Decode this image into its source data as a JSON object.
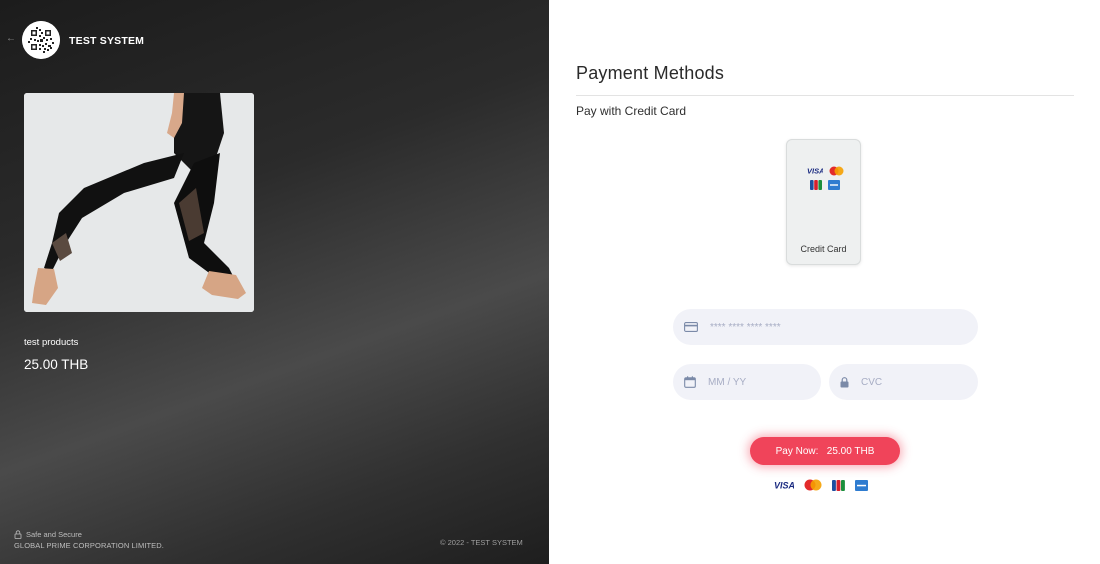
{
  "merchant": {
    "name": "TEST SYSTEM",
    "back_icon": "arrow-left-icon",
    "logo_icon": "qr-logo-icon"
  },
  "product": {
    "name": "test products",
    "price": "25.00 THB"
  },
  "footer": {
    "safe_label": "Safe and Secure",
    "company": "GLOBAL PRIME CORPORATION LIMITED.",
    "copyright": "© 2022 - TEST SYSTEM"
  },
  "payment": {
    "title": "Payment Methods",
    "subtitle": "Pay with Credit Card",
    "method_label": "Credit Card",
    "card_number_placeholder": "**** **** **** ****",
    "expiry_placeholder": "MM / YY",
    "cvc_placeholder": "CVC",
    "pay_button": "Pay Now:   25.00 THB",
    "card_brands": [
      "visa-icon",
      "mastercard-icon",
      "jcb-icon",
      "amex-icon"
    ],
    "card_brand_labels": {
      "visa": "VISA"
    }
  },
  "colors": {
    "accent": "#f0445a",
    "field_bg": "#f1f2f8",
    "left_panel": "#2b2b2b"
  }
}
